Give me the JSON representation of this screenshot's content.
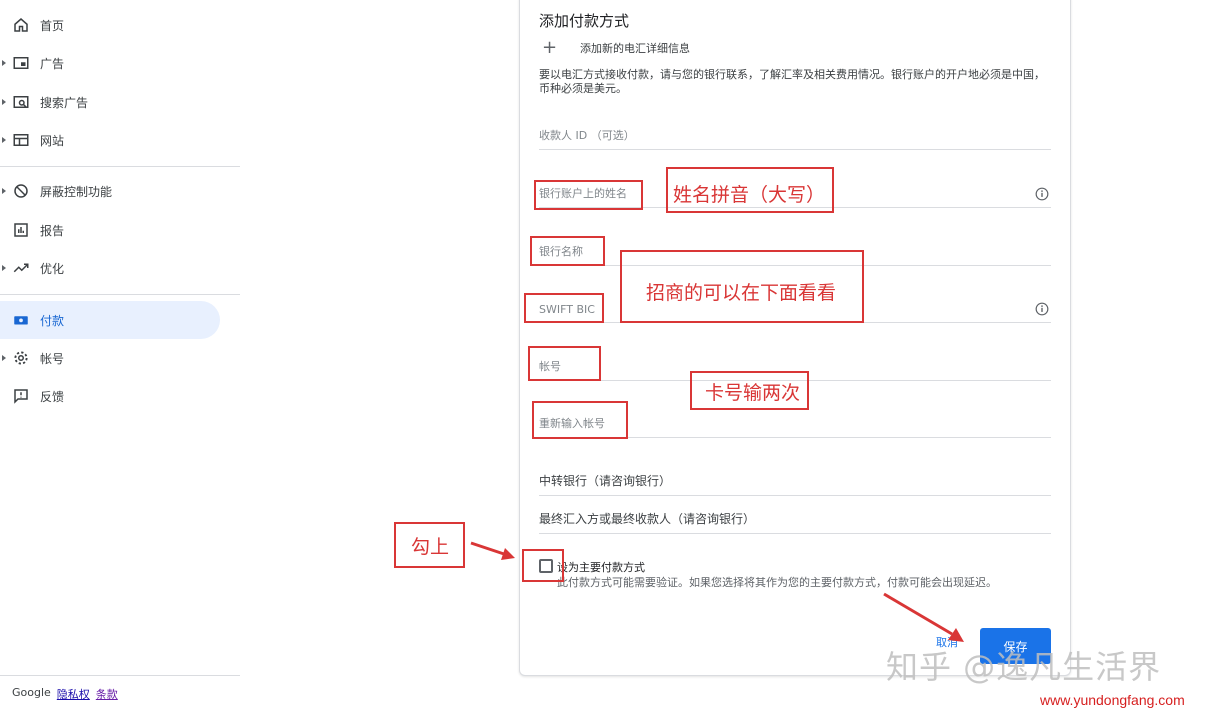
{
  "sidebar": {
    "items": [
      {
        "label": "首页",
        "icon": "home-icon"
      },
      {
        "label": "广告",
        "icon": "ad-icon"
      },
      {
        "label": "搜索广告",
        "icon": "search-ad-icon"
      },
      {
        "label": "网站",
        "icon": "website-icon"
      },
      {
        "label": "屏蔽控制功能",
        "icon": "block-icon"
      },
      {
        "label": "报告",
        "icon": "report-icon"
      },
      {
        "label": "优化",
        "icon": "trending-icon"
      },
      {
        "label": "付款",
        "icon": "payment-icon"
      },
      {
        "label": "帐号",
        "icon": "gear-icon"
      },
      {
        "label": "反馈",
        "icon": "feedback-icon"
      }
    ],
    "active": "付款",
    "footer": {
      "brand": "Google",
      "privacy": "隐私权",
      "terms": "条款"
    }
  },
  "form": {
    "title": "添加付款方式",
    "add_label": "添加新的电汇详细信息",
    "description": "要以电汇方式接收付款，请与您的银行联系，了解汇率及相关费用情况。银行账户的开户地必须是中国，币种必须是美元。",
    "fields": {
      "payee_id": "收款人 ID （可选）",
      "account_name": "银行账户上的姓名",
      "bank_name": "银行名称",
      "swift": "SWIFT BIC",
      "account_number": "帐号",
      "account_number_confirm": "重新输入帐号",
      "intermediary_bank": "中转银行（请咨询银行）",
      "final_beneficiary": "最终汇入方或最终收款人（请咨询银行）"
    },
    "primary_checkbox": {
      "label": "设为主要付款方式",
      "sub": "此付款方式可能需要验证。如果您选择将其作为您的主要付款方式，付款可能会出现延迟。",
      "checked": false
    },
    "cancel": "取消",
    "save": "保存"
  },
  "annotations": {
    "name_note": "姓名拼音（大写）",
    "swift_note": "招商的可以在下面看看",
    "account_note": "卡号输两次",
    "check_note": "勾上",
    "color": "#d93636"
  },
  "watermark": {
    "text": "知乎 @逸凡生活界",
    "url": "www.yundongfang.com"
  },
  "colors": {
    "accent": "#1a73e8",
    "active_bg": "#e8f0fe",
    "annotation": "#d93636"
  }
}
